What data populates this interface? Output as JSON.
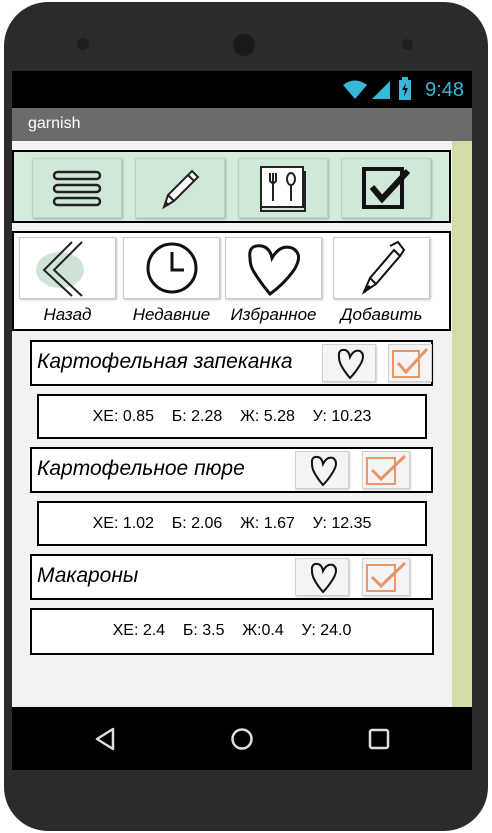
{
  "status_bar": {
    "time": "9:48"
  },
  "app": {
    "title": "garnish"
  },
  "toolbar_top": {
    "buttons": [
      "menu-icon",
      "pencil-icon",
      "recipe-book-icon",
      "checkbox-icon"
    ]
  },
  "toolbar_nav": {
    "buttons": [
      {
        "icon": "back-chevron-icon",
        "label": "Назад"
      },
      {
        "icon": "clock-icon",
        "label": "Недавние"
      },
      {
        "icon": "heart-icon",
        "label": "Избранное"
      },
      {
        "icon": "pen-icon",
        "label": "Добавить"
      }
    ]
  },
  "items": [
    {
      "name": "Картофельная запеканка",
      "nutrition": "ХЕ: 0.85    Б: 2.28    Ж: 5.28    У: 10.23"
    },
    {
      "name": "Картофельное пюре",
      "nutrition": "ХЕ: 1.02    Б: 2.06    Ж: 1.67    У: 12.35"
    },
    {
      "name": "Макароны",
      "nutrition": "ХЕ: 2.4    Б: 3.5    Ж:0.4    У: 24.0"
    }
  ],
  "colors": {
    "toolbar_bg": "#d4ecdc",
    "accent_orange": "#e8956a",
    "status_blue": "#38b8d8",
    "titlebar": "#6b6b6b",
    "side_strip": "#d2dca6"
  }
}
